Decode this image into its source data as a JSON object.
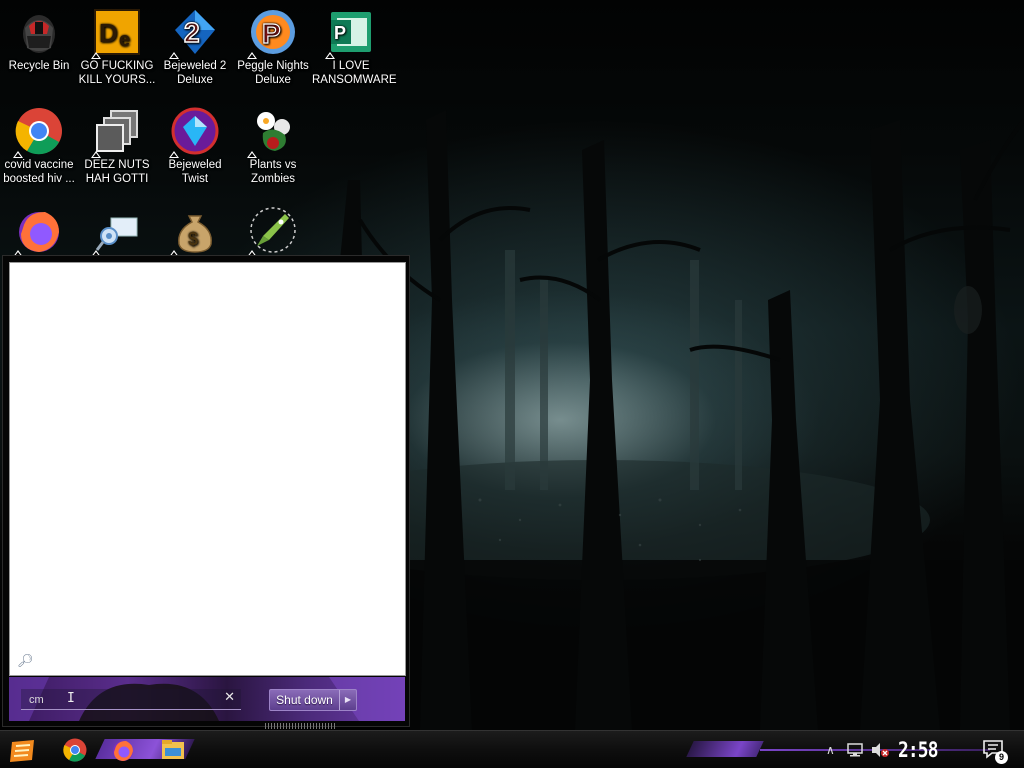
{
  "desktop": {
    "icons": [
      {
        "label": "Recycle Bin",
        "icon": "recycle-bin-icon"
      },
      {
        "label": "GO FUCKING KILL YOURS...",
        "icon": "adobe-dimension-icon"
      },
      {
        "label": "Bejeweled 2 Deluxe",
        "icon": "bejeweled-2-icon"
      },
      {
        "label": "Peggle Nights Deluxe",
        "icon": "peggle-icon"
      },
      {
        "label": "I LOVE RANSOMWARE",
        "icon": "ms-project-icon"
      },
      {
        "label": "covid vaccine boosted hiv ...",
        "icon": "chrome-icon"
      },
      {
        "label": "DEEZ NUTS HAH GOTTI",
        "icon": "stacked-windows-icon"
      },
      {
        "label": "Bejeweled Twist",
        "icon": "bejeweled-twist-icon"
      },
      {
        "label": "Plants vs Zombies",
        "icon": "plants-vs-zombies-icon"
      },
      {
        "label": "",
        "icon": "firefox-icon"
      },
      {
        "label": "",
        "icon": "network-icon"
      },
      {
        "label": "",
        "icon": "money-bag-icon"
      },
      {
        "label": "",
        "icon": "rocket-icon"
      }
    ]
  },
  "start_menu": {
    "search": {
      "value": "cm",
      "placeholder": ""
    },
    "shutdown_label": "Shut down",
    "clear_glyph": "✕"
  },
  "taskbar": {
    "apps": [
      "chrome-icon",
      "firefox-icon",
      "file-explorer-icon"
    ],
    "clock": "2:58 PM",
    "notifications_count": "9"
  },
  "colors": {
    "accent": "#7a45c8",
    "taskbar": "#0e0e0e"
  }
}
